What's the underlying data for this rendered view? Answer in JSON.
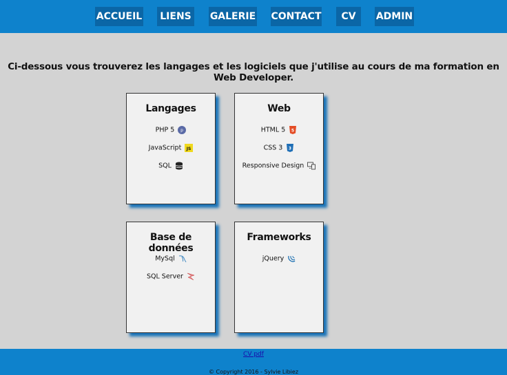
{
  "nav": {
    "items": [
      {
        "label": "ACCUEIL"
      },
      {
        "label": "LIENS"
      },
      {
        "label": "GALERIE"
      },
      {
        "label": "CONTACT"
      },
      {
        "label": "CV"
      },
      {
        "label": "ADMIN"
      }
    ]
  },
  "intro": "Ci-dessous vous trouverez les langages et les logiciels que j'utilise au cours de ma formation en Web Developer.",
  "cards": [
    {
      "title": "Langages",
      "items": [
        {
          "label": "PHP 5",
          "icon": "php-icon"
        },
        {
          "label": "JavaScript",
          "icon": "javascript-icon"
        },
        {
          "label": "SQL",
          "icon": "database-icon"
        }
      ]
    },
    {
      "title": "Web",
      "items": [
        {
          "label": "HTML 5",
          "icon": "html5-icon"
        },
        {
          "label": "CSS 3",
          "icon": "css3-icon"
        },
        {
          "label": "Responsive Design",
          "icon": "responsive-icon"
        }
      ]
    },
    {
      "title": "Base de données",
      "items": [
        {
          "label": "MySql",
          "icon": "mysql-icon"
        },
        {
          "label": "SQL Server",
          "icon": "sql-server-icon"
        }
      ]
    },
    {
      "title": "Frameworks",
      "items": [
        {
          "label": "jQuery",
          "icon": "jquery-icon"
        }
      ]
    }
  ],
  "footer": {
    "cv_link": "CV pdf",
    "copyright": "© Copyright 2016 - Sylvie Libiez"
  },
  "colors": {
    "bar": "#0e82cc",
    "nav_button": "#0b66a6",
    "background": "#d3d3d3",
    "card": "#f1f1f1",
    "shadow": "#1a73b8"
  }
}
